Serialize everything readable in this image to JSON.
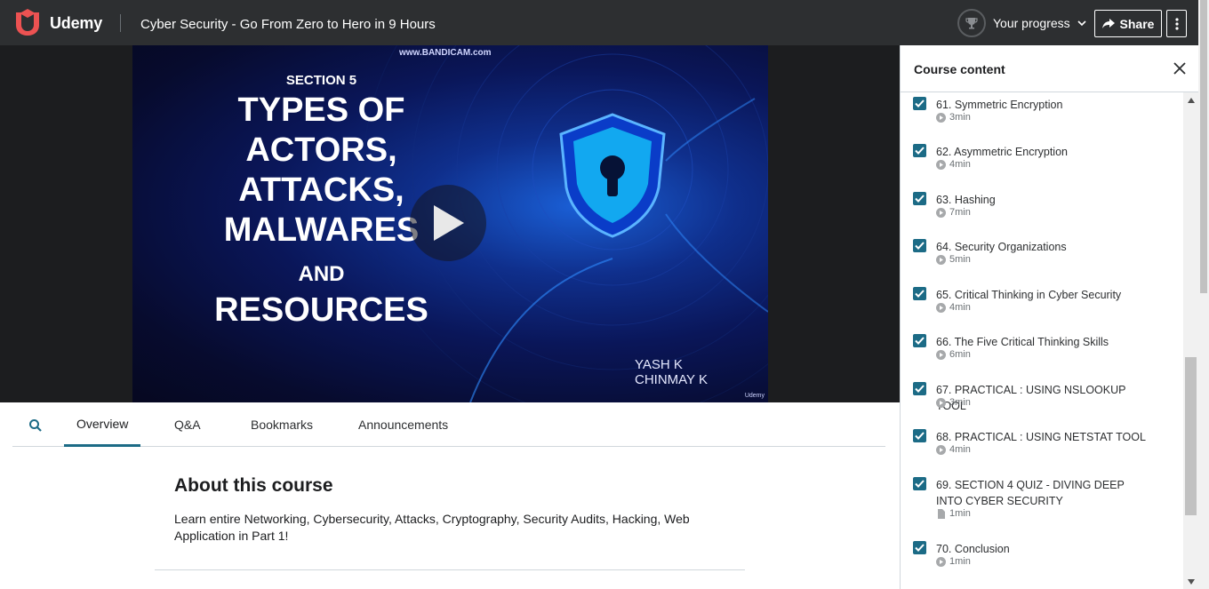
{
  "header": {
    "logo_text": "Udemy",
    "course_title": "Cyber Security - Go From Zero to Hero in 9 Hours",
    "progress_label": "Your progress",
    "share_label": "Share",
    "icons": [
      "trophy-icon",
      "chevron-down-icon",
      "share-arrow-icon",
      "more-vertical-icon"
    ]
  },
  "video": {
    "bandicam": "www.BANDICAM.com",
    "section_label": "SECTION 5",
    "lines": [
      "TYPES OF",
      "ACTORS,",
      "ATTACKS,",
      "MALWARES"
    ],
    "and_label": "AND",
    "last_line": "RESOURCES",
    "author1": "YASH K",
    "author2": "CHINMAY K",
    "watermark": "Udemy"
  },
  "tabs": {
    "overview": "Overview",
    "qa": "Q&A",
    "bookmarks": "Bookmarks",
    "announcements": "Announcements"
  },
  "about": {
    "title": "About this course",
    "text": "Learn entire Networking, Cybersecurity, Attacks, Cryptography, Security Audits, Hacking, Web Application in Part 1!"
  },
  "sidebar": {
    "title": "Course content",
    "lectures": [
      {
        "title": "61. Symmetric Encryption",
        "duration": "3min",
        "type": "video",
        "completed": true
      },
      {
        "title": "62. Asymmetric Encryption",
        "duration": "4min",
        "type": "video",
        "completed": true
      },
      {
        "title": "63. Hashing",
        "duration": "7min",
        "type": "video",
        "completed": true
      },
      {
        "title": "64. Security Organizations",
        "duration": "5min",
        "type": "video",
        "completed": true
      },
      {
        "title": "65. Critical Thinking in Cyber Security",
        "duration": "4min",
        "type": "video",
        "completed": true
      },
      {
        "title": "66. The Five Critical Thinking Skills",
        "duration": "6min",
        "type": "video",
        "completed": true
      },
      {
        "title": "67. PRACTICAL : USING NSLOOKUP TOOL",
        "duration": "3min",
        "type": "video",
        "completed": true
      },
      {
        "title": "68. PRACTICAL : USING NETSTAT TOOL",
        "duration": "4min",
        "type": "video",
        "completed": true
      },
      {
        "title": "69. SECTION 4 QUIZ - DIVING DEEP INTO CYBER SECURITY",
        "duration": "1min",
        "type": "document",
        "completed": true
      },
      {
        "title": "70. Conclusion",
        "duration": "1min",
        "type": "video",
        "completed": true
      }
    ]
  },
  "colors": {
    "header_bg": "#2d2f31",
    "accent": "#1c6b86",
    "brand": "#a435f0",
    "logo_red": "#ec5252"
  }
}
